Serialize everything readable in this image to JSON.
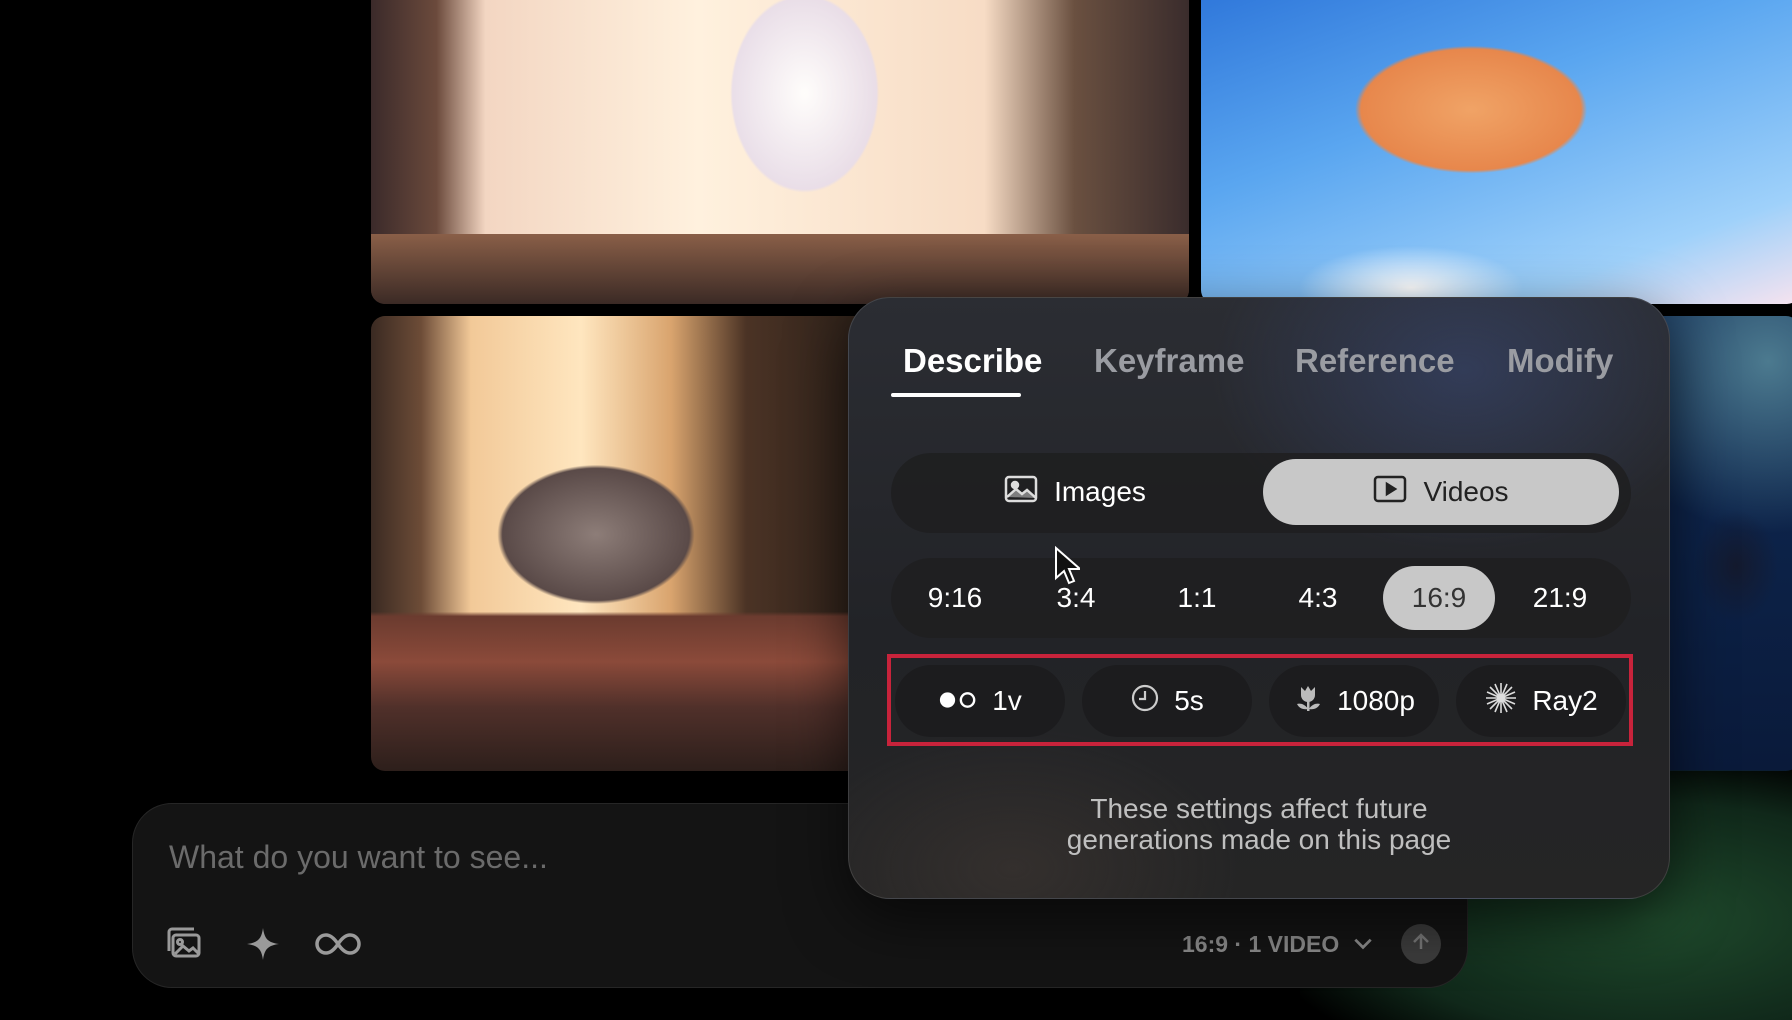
{
  "prompt": {
    "placeholder": "What do you want to see...",
    "settings_summary": "16:9 · 1 VIDEO",
    "icons": [
      "image-gallery-icon",
      "sparkle-icon",
      "infinity-loop-icon",
      "chevron-down-icon",
      "arrow-up-icon"
    ]
  },
  "panel": {
    "tabs": [
      "Describe",
      "Keyframe",
      "Reference",
      "Modify"
    ],
    "active_tab": "Describe",
    "media_types": [
      "Images",
      "Videos"
    ],
    "selected_media": "Videos",
    "aspect_ratios": [
      "9:16",
      "3:4",
      "1:1",
      "4:3",
      "16:9",
      "21:9"
    ],
    "selected_aspect": "16:9",
    "settings": {
      "variants": "1v",
      "duration": "5s",
      "resolution": "1080p",
      "model": "Ray2"
    },
    "footnote_line1": "These settings affect future",
    "footnote_line2": "generations made on this page"
  },
  "colors": {
    "highlight": "#c8233b",
    "selected_pill": "#c8c8c8"
  }
}
